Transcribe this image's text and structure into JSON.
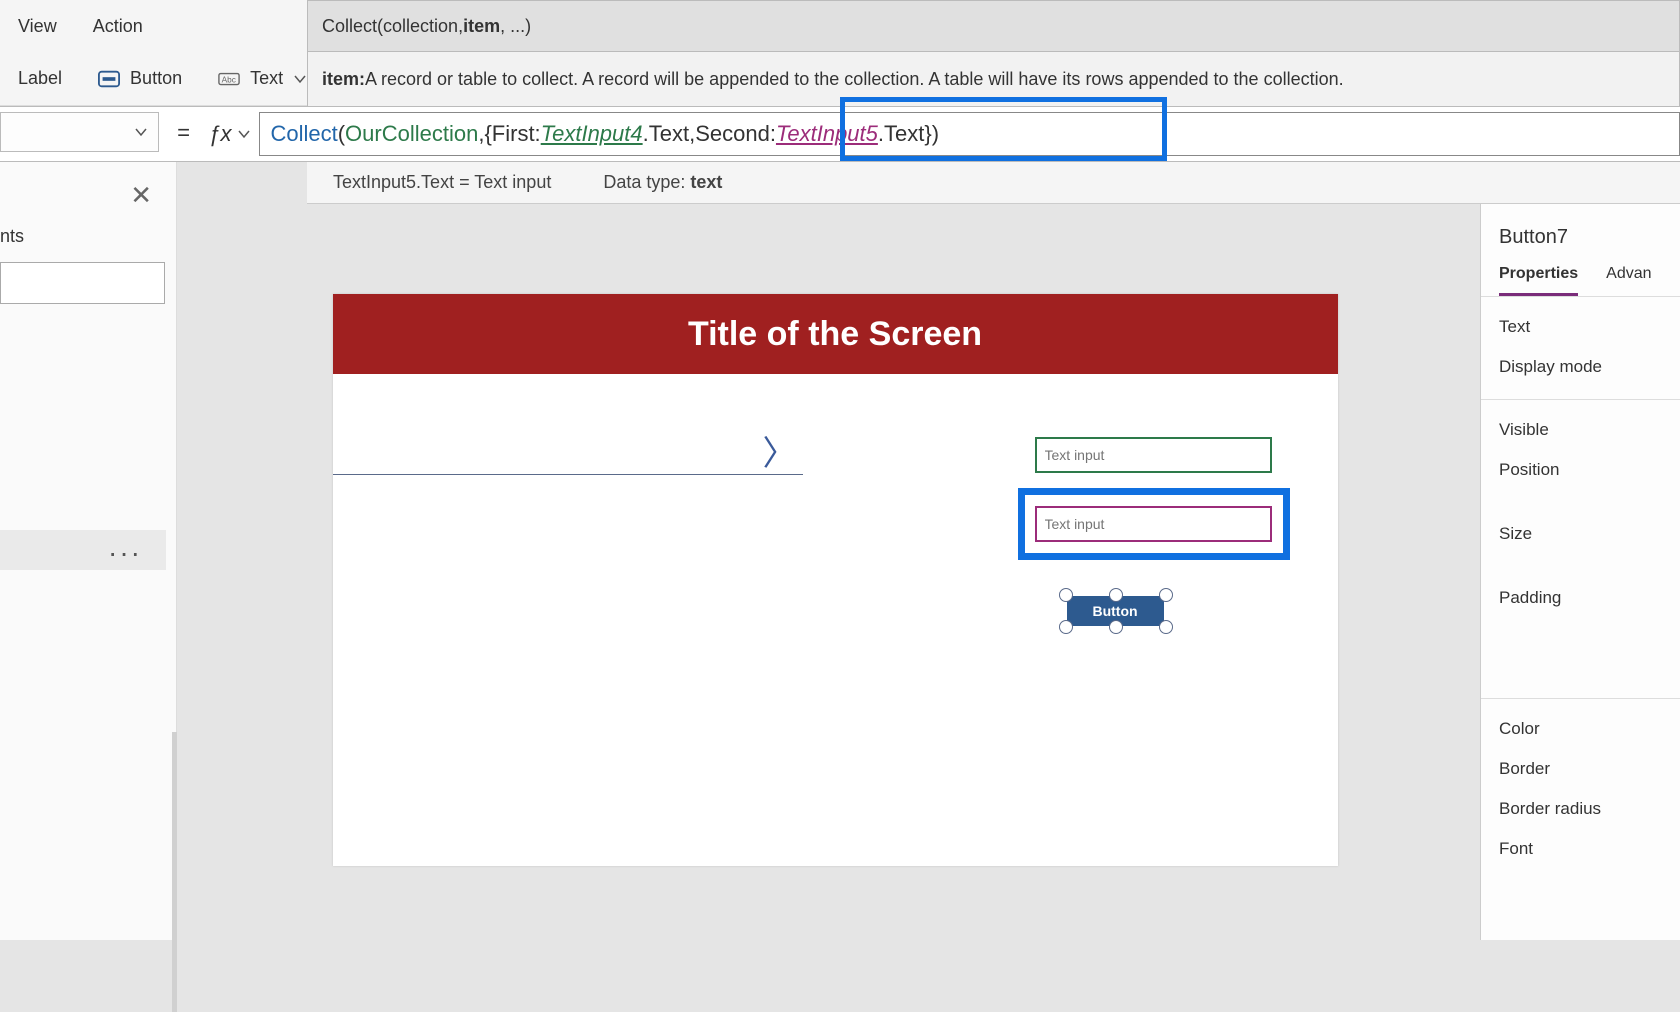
{
  "menu": {
    "view": "View",
    "action": "Action"
  },
  "formula_help": {
    "fn": "Collect",
    "sig_prefix": "(collection, ",
    "sig_bold": "item",
    "sig_suffix": ", ...)"
  },
  "ribbon": {
    "label": "Label",
    "button": "Button",
    "text": "Text"
  },
  "help_detail": {
    "prefix": "item: ",
    "body": "A record or table to collect. A record will be appended to the collection. A table will have its rows appended to the collection."
  },
  "formula": {
    "fn": "Collect",
    "open": "(",
    "collection": "OurCollection",
    "comma1": ", ",
    "brace_open": "{",
    "key1": "First: ",
    "ref1": "TextInput4",
    "suffix1": ".Text",
    "comma2": ", ",
    "key2": "Second: ",
    "ref2": "TextInput5",
    "suffix2": ".Text",
    "brace_close": "}",
    "close": ")",
    "equals": "="
  },
  "formula_info": {
    "lhs": "TextInput5.Text",
    "eq": " = ",
    "rhs": "Text input",
    "dt_label": "Data type: ",
    "dt_value": "text"
  },
  "left_panel": {
    "close": "✕",
    "label": "nts",
    "dots": "···"
  },
  "canvas": {
    "title": "Title of the Screen",
    "arrow": "〉",
    "ti1_placeholder": "Text input",
    "ti2_placeholder": "Text input",
    "button_label": "Button"
  },
  "props": {
    "selected": "Button7",
    "tabs": {
      "properties": "Properties",
      "advanced": "Advan"
    },
    "items": [
      "Text",
      "Display mode",
      "Visible",
      "Position",
      "Size",
      "Padding",
      "Color",
      "Border",
      "Border radius",
      "Font"
    ]
  }
}
